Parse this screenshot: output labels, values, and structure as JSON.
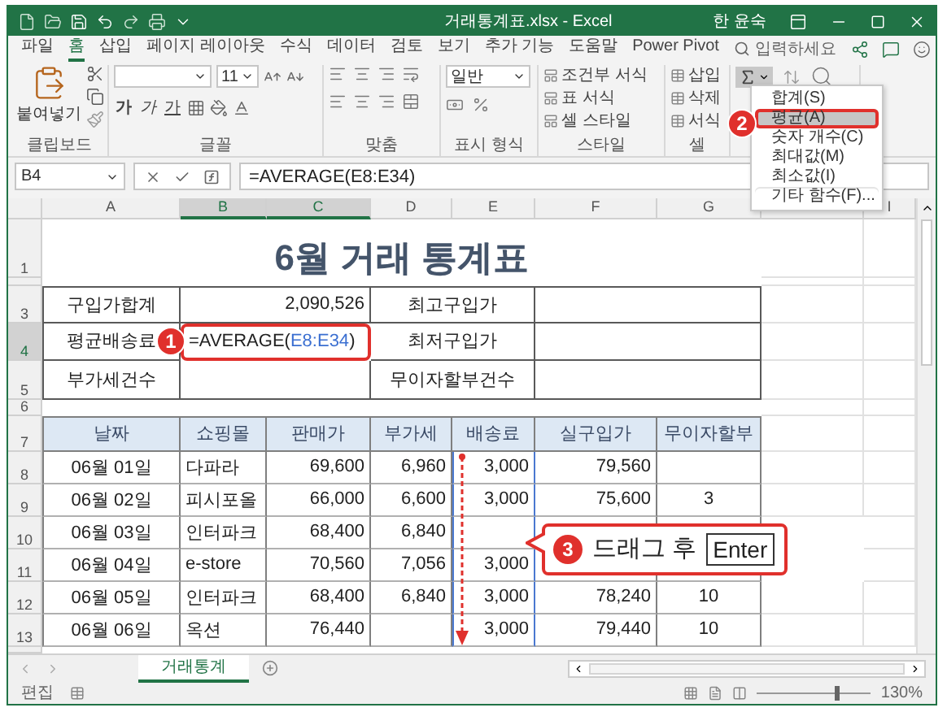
{
  "title_bar": {
    "title": "거래통계표.xlsx - Excel",
    "user": "한 윤숙"
  },
  "ribbon_tabs": [
    {
      "label": "파일",
      "selected": false
    },
    {
      "label": "홈",
      "selected": true
    },
    {
      "label": "삽입",
      "selected": false
    },
    {
      "label": "페이지 레이아웃",
      "selected": false
    },
    {
      "label": "수식",
      "selected": false
    },
    {
      "label": "데이터",
      "selected": false
    },
    {
      "label": "검토",
      "selected": false
    },
    {
      "label": "보기",
      "selected": false
    },
    {
      "label": "추가 기능",
      "selected": false
    },
    {
      "label": "도움말",
      "selected": false
    },
    {
      "label": "Power Pivot",
      "selected": false
    }
  ],
  "search": {
    "placeholder": "입력하세요"
  },
  "ribbon": {
    "clipboard": {
      "paste": "붙여넣기",
      "label": "클립보드"
    },
    "font": {
      "size": "11",
      "style_buttons": [
        "가",
        "가",
        "가"
      ],
      "label": "글꼴"
    },
    "alignment": {
      "label": "맞춤"
    },
    "number": {
      "format": "일반",
      "label": "표시 형식"
    },
    "styles": {
      "items": [
        "조건부 서식",
        "표 서식",
        "셀 스타일"
      ],
      "label": "스타일"
    },
    "cells": {
      "items": [
        "삽입",
        "삭제",
        "서식"
      ],
      "label": "셀"
    }
  },
  "autosum_menu": {
    "items": [
      {
        "label": "합계(S)",
        "selected": false
      },
      {
        "label": "평균(A)",
        "selected": true
      },
      {
        "label": "숫자 개수(C)",
        "selected": false
      },
      {
        "label": "최대값(M)",
        "selected": false
      },
      {
        "label": "최소값(I)",
        "selected": false
      },
      {
        "label": "기타 함수(F)...",
        "selected": false
      }
    ]
  },
  "formula_bar": {
    "name_box": "B4",
    "formula": "=AVERAGE(E8:E34)"
  },
  "sheet": {
    "column_headers": [
      {
        "label": "A",
        "selected": false
      },
      {
        "label": "B",
        "selected": true
      },
      {
        "label": "C",
        "selected": true
      },
      {
        "label": "D",
        "selected": false
      },
      {
        "label": "E",
        "selected": false
      },
      {
        "label": "F",
        "selected": false
      },
      {
        "label": "G",
        "selected": false
      },
      {
        "selected": false
      },
      {
        "label": "I",
        "selected": false
      }
    ],
    "row_headers": [
      {
        "label": "1",
        "selected": false
      },
      {
        "selected": false
      },
      {
        "label": "3",
        "selected": false
      },
      {
        "label": "4",
        "selected": true
      },
      {
        "label": "5",
        "selected": false
      },
      {
        "label": "6",
        "selected": false
      },
      {
        "label": "7",
        "selected": false
      },
      {
        "label": "8",
        "selected": false
      },
      {
        "label": "9",
        "selected": false
      },
      {
        "label": "10",
        "selected": false
      },
      {
        "label": "11",
        "selected": false
      },
      {
        "label": "12",
        "selected": false
      },
      {
        "label": "13",
        "selected": false
      }
    ],
    "title": "6월 거래 통계표",
    "summary": [
      {
        "left": {
          "label": "구입가합계",
          "value": "2,090,526",
          "selected": false
        },
        "right": {
          "label": "최고구입가"
        }
      },
      {
        "left": {
          "label": "평균배송료",
          "formula": [
            {
              "text": "=AVERAGE(",
              "kind": "plain"
            },
            {
              "text": "E8:E34",
              "kind": "reference"
            },
            {
              "text": ")",
              "kind": "plain"
            }
          ],
          "selected": true
        },
        "right": {
          "label": "최저구입가"
        }
      },
      {
        "left": {
          "label": "부가세건수",
          "selected": false
        },
        "right": {
          "label": "무이자할부건수"
        }
      }
    ],
    "table": {
      "columns": [
        {
          "label": "날짜",
          "referenced": false
        },
        {
          "label": "쇼핑몰",
          "referenced": false
        },
        {
          "label": "판매가",
          "referenced": false
        },
        {
          "label": "부가세",
          "referenced": false
        },
        {
          "label": "배송료",
          "referenced": true
        },
        {
          "label": "실구입가",
          "referenced": false
        },
        {
          "label": "무이자할부",
          "referenced": false
        }
      ],
      "rows": [
        {
          "cells": [
            "06월 01일",
            "다파라",
            "69,600",
            "6,960",
            "3,000",
            "79,560",
            null
          ]
        },
        {
          "cells": [
            "06월 02일",
            "피시포올",
            "66,000",
            "6,600",
            "3,000",
            "75,600",
            "3"
          ]
        },
        {
          "cells": [
            "06월 03일",
            "인터파크",
            "68,400",
            "6,840",
            null,
            null,
            null
          ]
        },
        {
          "cells": [
            "06월 04일",
            "e-store",
            "70,560",
            "7,056",
            "3,000",
            null,
            null
          ]
        },
        {
          "cells": [
            "06월 05일",
            "인터파크",
            "68,400",
            "6,840",
            "3,000",
            "78,240",
            "10"
          ]
        },
        {
          "cells": [
            "06월 06일",
            "옥션",
            "76,440",
            null,
            "3,000",
            "79,440",
            "10"
          ]
        }
      ]
    }
  },
  "sheet_tabs": [
    {
      "label": "거래통계",
      "selected": true
    }
  ],
  "status_bar": {
    "mode": "편집",
    "zoom": "130%",
    "level": 0.7
  },
  "annotations": {
    "cell_badge": "1",
    "menu_badge": "2",
    "callout": {
      "badge": "3",
      "text": "드래그 후",
      "key": "Enter"
    }
  }
}
